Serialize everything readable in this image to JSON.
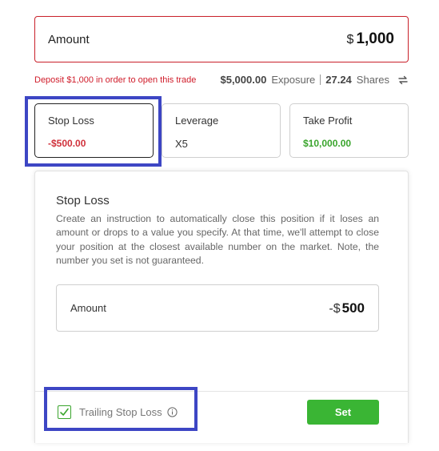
{
  "amount": {
    "label": "Amount",
    "currency": "$",
    "value": "1,000"
  },
  "deposit_warning": "Deposit $1,000 in order to open this trade",
  "exposure": {
    "value": "$5,000.00",
    "exposure_label": "Exposure",
    "shares_value": "27.24",
    "shares_label": "Shares",
    "swap_icon": "swap-icon"
  },
  "tabs": [
    {
      "title": "Stop Loss",
      "value": "-$500.00",
      "color": "#d0313b",
      "active": true
    },
    {
      "title": "Leverage",
      "value": "X5"
    },
    {
      "title": "Take Profit",
      "value": "$10,000.00",
      "color": "#3aa52d"
    }
  ],
  "stop_loss_panel": {
    "title": "Stop Loss",
    "description": "Create an instruction to automatically close this position if it loses an amount or drops to a value you specify. At that time, we'll attempt to close your position at the closest available number on the market. Note, the number you set is not guaranteed.",
    "amount": {
      "label": "Amount",
      "prefix": "-$",
      "value": "500"
    },
    "trailing_stop": {
      "label": "Trailing Stop Loss",
      "checked": true,
      "info_icon": "info-icon"
    },
    "set_button": "Set"
  },
  "colors": {
    "accent_red": "#c9202a",
    "green": "#3ab534",
    "highlight": "#3d46c4"
  }
}
